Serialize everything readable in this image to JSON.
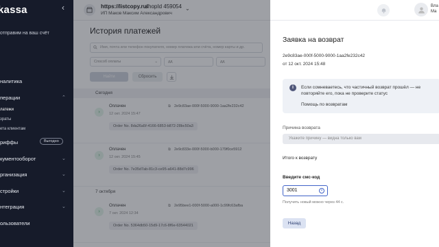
{
  "sidebar": {
    "logo": "kassa",
    "collapse_icon": "chevron-left-icon",
    "sent_text": "отправим на ваш счёт",
    "items": [
      {
        "label": "налитика",
        "chevron": ""
      },
      {
        "label": "перации",
        "chevron": "^"
      },
      {
        "label": "риффы",
        "chevron": ""
      },
      {
        "label": "кументооборот",
        "chevron": "v"
      },
      {
        "label": "рганизация",
        "chevron": "v"
      },
      {
        "label": "стройки",
        "chevron": "v"
      },
      {
        "label": "нтеграция",
        "chevron": "v"
      },
      {
        "label": "ользователи",
        "chevron": ""
      }
    ],
    "subitems": [
      "латежи",
      "зраты",
      "ета клиентам"
    ],
    "tariff_badge": "Выгодно"
  },
  "topbar": {
    "shop_url": "https://listcopy.ru/",
    "shop_id": "shopId 459054",
    "shop_owner": "ИП Маков Максим Александрович",
    "user_line1": "Вла",
    "user_line2": "Ма"
  },
  "main": {
    "title": "История платежей",
    "search_placeholder": "Имя, почта или телефон покупателя, номер платежа или счёта, номер карты и др.",
    "payment_method_placeholder": "Способ оплаты",
    "date_from": "дд",
    "date_to": "дд",
    "find_label": "Найти",
    "reset_label": "Сбросить",
    "groups": [
      {
        "day": "Сегодня",
        "rows": [
          {
            "status": "Оплачен",
            "date": "12 окт. 2024 15:47",
            "payment_id": "2e9c83ae-000f-5000-9000-1aa2fe232c42",
            "order": "Order No. 8da26a5f-4166-6853-b872-28bc50a3"
          },
          {
            "status": "Оплачен",
            "date": "12 окт. 2024 15:45",
            "payment_id": "2e9c833e-000f-5000-b000-179f0ce5912",
            "order": "Order No. 7e35d7ab-81c3-ce95-a641-88d7c996"
          }
        ]
      },
      {
        "day": "7 октября",
        "rows": [
          {
            "status": "Оплачен",
            "date": "7 окт. 2024 12:34",
            "payment_id": "2e95bee1-000f-5000-a000-1c99fc63afba",
            "order": "Order No. 5364db50-15d9-17c6-8f6e-63544021"
          }
        ]
      }
    ]
  },
  "panel": {
    "title": "Заявка на возврат",
    "payment_id": "2e9c83ae-000f-5000-9000-1aa2fe232c42",
    "payment_date": "от 12 окт. 2024 15:48",
    "info_text": "Если сомневаетесь, что частичный возврат прошёл — не повторяйте его, пока не проверите статус",
    "info_link": "Помощь по возвратам",
    "reason_label": "Причина возврата",
    "reason_placeholder": "Укажите причину — видна только вам",
    "total_label": "Итого к возврату",
    "sms_label": "Введите смс-код",
    "sms_value": "3001",
    "sms_hint": "Получить новый можно через 44 с.",
    "back_label": "Назад"
  }
}
